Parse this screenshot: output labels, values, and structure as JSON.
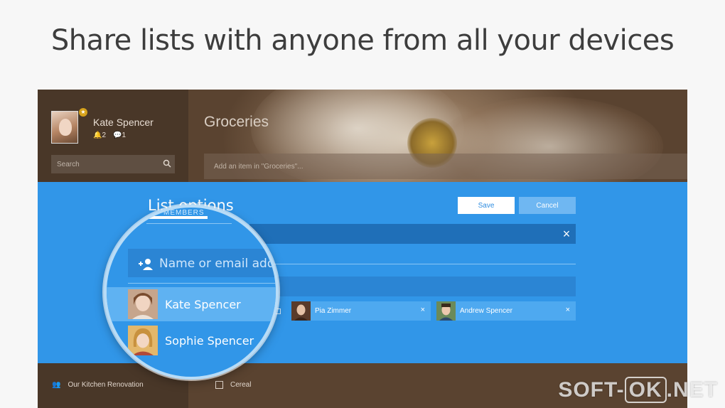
{
  "headline": "Share lists with anyone from all your devices",
  "app": {
    "profile": {
      "name": "Kate Spencer",
      "notifications": "2",
      "messages": "1"
    },
    "search": {
      "placeholder": "Search"
    },
    "list_title": "Groceries",
    "add_item": {
      "placeholder": "Add an item in \"Groceries\"..."
    },
    "sidebar_items": [
      {
        "label": "Our Kitchen Renovation"
      }
    ],
    "list_items": [
      {
        "label": "Cereal"
      }
    ]
  },
  "options": {
    "title": "List options",
    "save_label": "Save",
    "cancel_label": "Cancel",
    "tab_members": "MEMBERS",
    "close_symbol": "×",
    "members": [
      {
        "name": "Pia Zimmer"
      },
      {
        "name": "Andrew Spencer"
      }
    ],
    "remove_symbol": "×"
  },
  "magnifier": {
    "input_placeholder": "Name or email add",
    "suggestions": [
      {
        "name": "Kate Spencer"
      },
      {
        "name": "Sophie Spencer"
      }
    ]
  },
  "watermark": {
    "left": "SOFT-",
    "box": "OK",
    "right": ".NET"
  },
  "colors": {
    "accent": "#3196e8",
    "dark_accent": "#1f6fb8",
    "chip": "#4ea9f0"
  }
}
